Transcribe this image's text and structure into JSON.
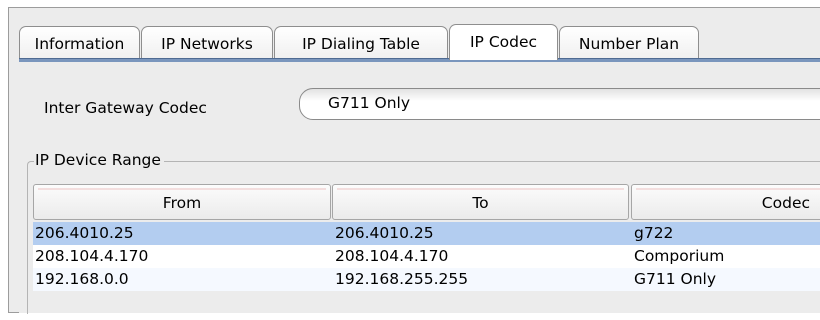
{
  "tabs": [
    {
      "label": "Information",
      "active": false
    },
    {
      "label": "IP Networks",
      "active": false
    },
    {
      "label": "IP Dialing Table",
      "active": false
    },
    {
      "label": "IP Codec",
      "active": true
    },
    {
      "label": "Number Plan",
      "active": false
    }
  ],
  "codec": {
    "label": "Inter Gateway Codec",
    "value": "G711 Only"
  },
  "range_group": {
    "title": "IP Device Range"
  },
  "table": {
    "columns": [
      "From",
      "To",
      "Codec"
    ],
    "rows": [
      {
        "from": "206.4010.25",
        "to": "206.4010.25",
        "codec": "g722",
        "selected": true
      },
      {
        "from": "208.104.4.170",
        "to": "208.104.4.170",
        "codec": "Comporium",
        "selected": false
      },
      {
        "from": "192.168.0.0",
        "to": "192.168.255.255",
        "codec": "G711 Only",
        "selected": false
      }
    ]
  },
  "colors": {
    "selection": "#b3cdf0",
    "tab_underline": "#7a96bd",
    "panel_bg": "#ececec"
  }
}
